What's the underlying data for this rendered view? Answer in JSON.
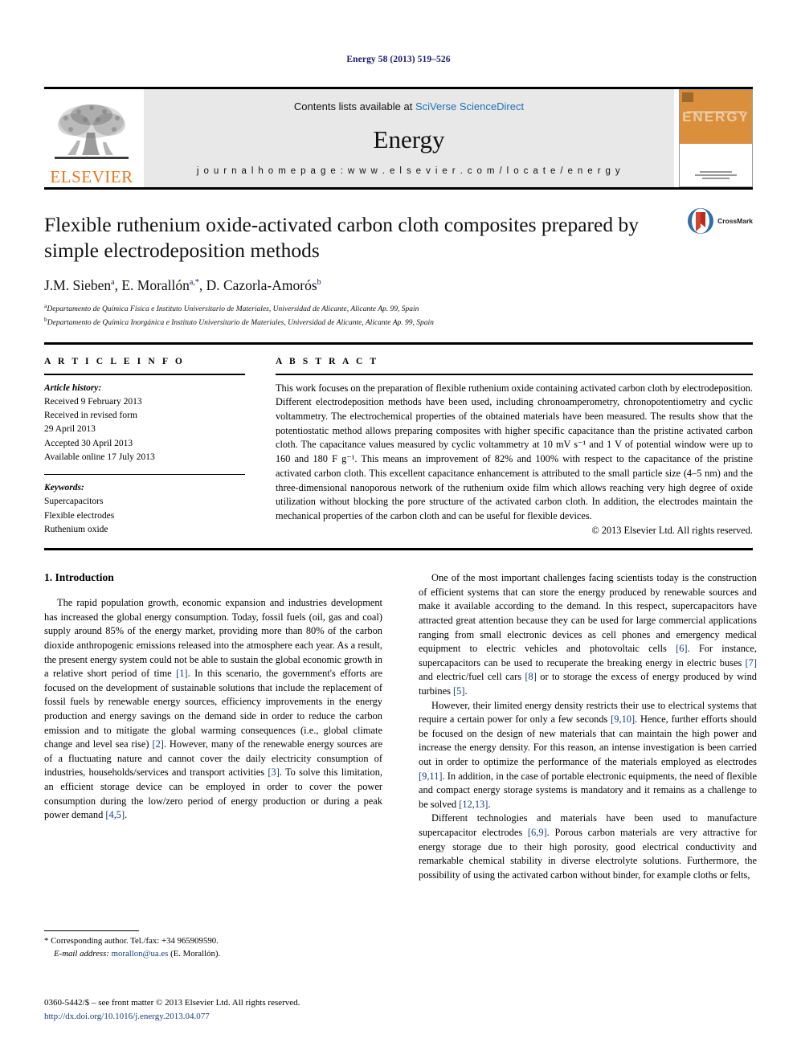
{
  "running_head": "Energy 58 (2013) 519–526",
  "masthead": {
    "contents_prefix": "Contents lists available at ",
    "contents_link": "SciVerse ScienceDirect",
    "journal_name": "Energy",
    "homepage_line": "j o u r n a l   h o m e p a g e :   w w w . e l s e v i e r . c o m / l o c a t e / e n e r g y",
    "elsevier_word": "ELSEVIER",
    "cover_title": "ENERGY",
    "logo_icon": "elsevier-tree-icon"
  },
  "title_block": {
    "title": "Flexible ruthenium oxide-activated carbon cloth composites prepared by simple electrodeposition methods",
    "crossmark_label": "CrossMark",
    "authors_html": "J.M. Sieben <sup>a</sup>, E. Morallón <sup>a,</sup><sup>*</sup>, D. Cazorla-Amorós <sup>b</sup>",
    "affiliations": [
      {
        "marker": "a",
        "text": "Departamento de Química Física e Instituto Universitario de Materiales, Universidad de Alicante, Alicante Ap. 99, Spain"
      },
      {
        "marker": "b",
        "text": "Departamento de Química Inorgánica e Instituto Universitario de Materiales, Universidad de Alicante, Alicante Ap. 99, Spain"
      }
    ]
  },
  "article_info": {
    "heading": "A R T I C L E   I N F O",
    "history_label": "Article history:",
    "history": [
      "Received 9 February 2013",
      "Received in revised form",
      "29 April 2013",
      "Accepted 30 April 2013",
      "Available online 17 July 2013"
    ],
    "keywords_label": "Keywords:",
    "keywords": [
      "Supercapacitors",
      "Flexible electrodes",
      "Ruthenium oxide"
    ]
  },
  "abstract": {
    "heading": "A B S T R A C T",
    "text": "This work focuses on the preparation of flexible ruthenium oxide containing activated carbon cloth by electrodeposition. Different electrodeposition methods have been used, including chronoamperometry, chronopotentiometry and cyclic voltammetry. The electrochemical properties of the obtained materials have been measured. The results show that the potentiostatic method allows preparing composites with higher specific capacitance than the pristine activated carbon cloth. The capacitance values measured by cyclic voltammetry at 10 mV s⁻¹ and 1 V of potential window were up to 160 and 180 F g⁻¹. This means an improvement of 82% and 100% with respect to the capacitance of the pristine activated carbon cloth. This excellent capacitance enhancement is attributed to the small particle size (4–5 nm) and the three-dimensional nanoporous network of the ruthenium oxide film which allows reaching very high degree of oxide utilization without blocking the pore structure of the activated carbon cloth. In addition, the electrodes maintain the mechanical properties of the carbon cloth and can be useful for flexible devices.",
    "copyright": "© 2013 Elsevier Ltd. All rights reserved."
  },
  "body": {
    "section_title": "1. Introduction",
    "left_paragraphs": [
      "The rapid population growth, economic expansion and industries development has increased the global energy consumption. Today, fossil fuels (oil, gas and coal) supply around 85% of the energy market, providing more than 80% of the carbon dioxide anthropogenic emissions released into the atmosphere each year. As a result, the present energy system could not be able to sustain the global economic growth in a relative short period of time [1]. In this scenario, the government's efforts are focused on the development of sustainable solutions that include the replacement of fossil fuels by renewable energy sources, efficiency improvements in the energy production and energy savings on the demand side in order to reduce the carbon emission and to mitigate the global warming consequences (i.e., global climate change and level sea rise) [2]. However, many of the renewable energy sources are of a fluctuating nature and cannot cover the daily electricity consumption of industries, households/services and transport activities [3]. To solve this limitation, an efficient storage device can be employed in order to cover the power consumption during the low/zero period of energy production or during a peak power demand [4,5]."
    ],
    "right_paragraphs": [
      "One of the most important challenges facing scientists today is the construction of efficient systems that can store the energy produced by renewable sources and make it available according to the demand. In this respect, supercapacitors have attracted great attention because they can be used for large commercial applications ranging from small electronic devices as cell phones and emergency medical equipment to electric vehicles and photovoltaic cells [6]. For instance, supercapacitors can be used to recuperate the breaking energy in electric buses [7] and electric/fuel cell cars [8] or to storage the excess of energy produced by wind turbines [5].",
      "However, their limited energy density restricts their use to electrical systems that require a certain power for only a few seconds [9,10]. Hence, further efforts should be focused on the design of new materials that can maintain the high power and increase the energy density. For this reason, an intense investigation is been carried out in order to optimize the performance of the materials employed as electrodes [9,11]. In addition, in the case of portable electronic equipments, the need of flexible and compact energy storage systems is mandatory and it remains as a challenge to be solved [12,13].",
      "Different technologies and materials have been used to manufacture supercapacitor electrodes [6,9]. Porous carbon materials are very attractive for energy storage due to their high porosity, good electrical conductivity and remarkable chemical stability in diverse electrolyte solutions. Furthermore, the possibility of using the activated carbon without binder, for example cloths or felts,"
    ]
  },
  "footnotes": {
    "corresponding": "* Corresponding author. Tel./fax: +34 965909590.",
    "email_label": "E-mail address:",
    "email": "morallon@ua.es",
    "email_suffix": "(E. Morallón)."
  },
  "issn": {
    "line1": "0360-5442/$ – see front matter © 2013 Elsevier Ltd. All rights reserved.",
    "doi": "http://dx.doi.org/10.1016/j.energy.2013.04.077"
  },
  "colors": {
    "link_blue": "#1f6fb5",
    "ref_blue": "#1a3b7a",
    "header_blue": "#1a1a6e",
    "elsevier_orange": "#E87722",
    "cover_orange": "#d98f3c",
    "masthead_gray": "#e8e8e8"
  }
}
